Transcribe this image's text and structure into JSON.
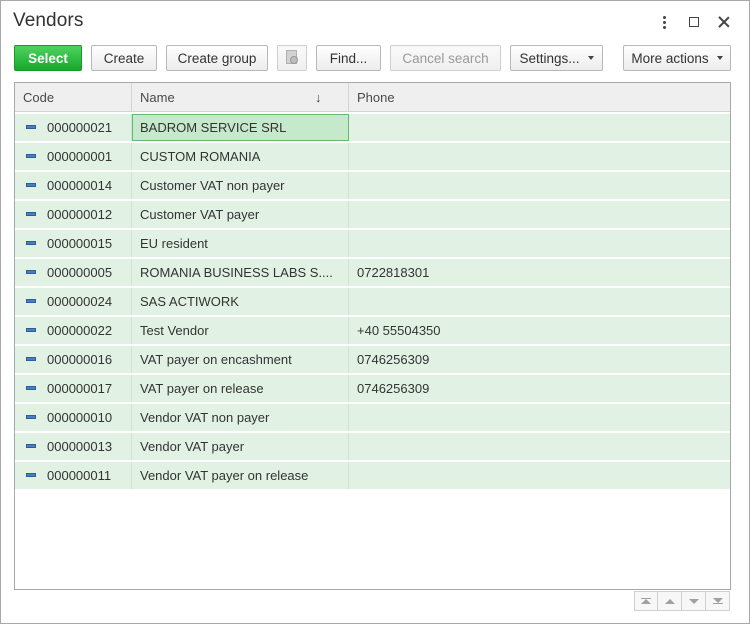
{
  "window": {
    "title": "Vendors"
  },
  "toolbar": {
    "select": "Select",
    "create": "Create",
    "create_group": "Create group",
    "find": "Find...",
    "cancel_search": "Cancel search",
    "settings": "Settings...",
    "more_actions": "More actions"
  },
  "table": {
    "columns": [
      "Code",
      "Name",
      "Phone"
    ],
    "sort_indicator": "↓",
    "rows": [
      {
        "code": "000000021",
        "name": "BADROM SERVICE SRL",
        "phone": ""
      },
      {
        "code": "000000001",
        "name": "CUSTOM ROMANIA",
        "phone": ""
      },
      {
        "code": "000000014",
        "name": "Customer VAT non payer",
        "phone": ""
      },
      {
        "code": "000000012",
        "name": "Customer VAT payer",
        "phone": ""
      },
      {
        "code": "000000015",
        "name": "EU resident",
        "phone": ""
      },
      {
        "code": "000000005",
        "name": "ROMANIA BUSINESS LABS S....",
        "phone": "0722818301"
      },
      {
        "code": "000000024",
        "name": "SAS ACTIWORK",
        "phone": ""
      },
      {
        "code": "000000022",
        "name": "Test Vendor",
        "phone": "+40 55504350"
      },
      {
        "code": "000000016",
        "name": "VAT payer on encashment",
        "phone": "0746256309"
      },
      {
        "code": "000000017",
        "name": "VAT payer on release",
        "phone": "0746256309"
      },
      {
        "code": "000000010",
        "name": "Vendor VAT non payer",
        "phone": ""
      },
      {
        "code": "000000013",
        "name": "Vendor VAT payer",
        "phone": ""
      },
      {
        "code": "000000011",
        "name": "Vendor VAT payer on release",
        "phone": ""
      }
    ]
  },
  "colors": {
    "select_button": "#16a82d",
    "row_bg": "#e1f2e4",
    "selected_cell": "#c6e9cb"
  }
}
